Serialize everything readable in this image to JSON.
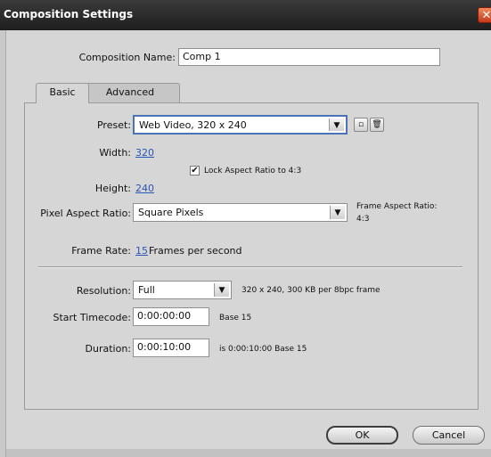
{
  "window": {
    "title": "Composition Settings",
    "close_glyph": "✕"
  },
  "comp_name": {
    "label": "Composition Name:",
    "value": "Comp 1"
  },
  "tabs": [
    {
      "label": "Basic"
    },
    {
      "label": "Advanced"
    }
  ],
  "preset": {
    "label": "Preset:",
    "value": "Web Video, 320 x 240"
  },
  "width": {
    "label": "Width:",
    "value": "320"
  },
  "height": {
    "label": "Height:",
    "value": "240"
  },
  "lock_aspect": {
    "label": "Lock Aspect Ratio to 4:3",
    "checked": true,
    "mark": "✔"
  },
  "pixel_aspect": {
    "label": "Pixel Aspect Ratio:",
    "value": "Square Pixels",
    "frame_aspect_label": "Frame Aspect Ratio:",
    "frame_aspect_value": "4:3"
  },
  "frame_rate": {
    "label": "Frame Rate:",
    "value": "15",
    "unit": "Frames per second"
  },
  "resolution": {
    "label": "Resolution:",
    "value": "Full",
    "info": "320 x 240, 300 KB per 8bpc frame"
  },
  "start_timecode": {
    "label": "Start Timecode:",
    "value": "0:00:00:00",
    "info": "Base 15"
  },
  "duration": {
    "label": "Duration:",
    "value": "0:00:10:00",
    "info": "is 0:00:10:00  Base 15"
  },
  "buttons": {
    "ok": "OK",
    "cancel": "Cancel"
  },
  "icons": {
    "dropdown": "▼",
    "save_preset": "▫",
    "delete_preset": "🗑"
  }
}
